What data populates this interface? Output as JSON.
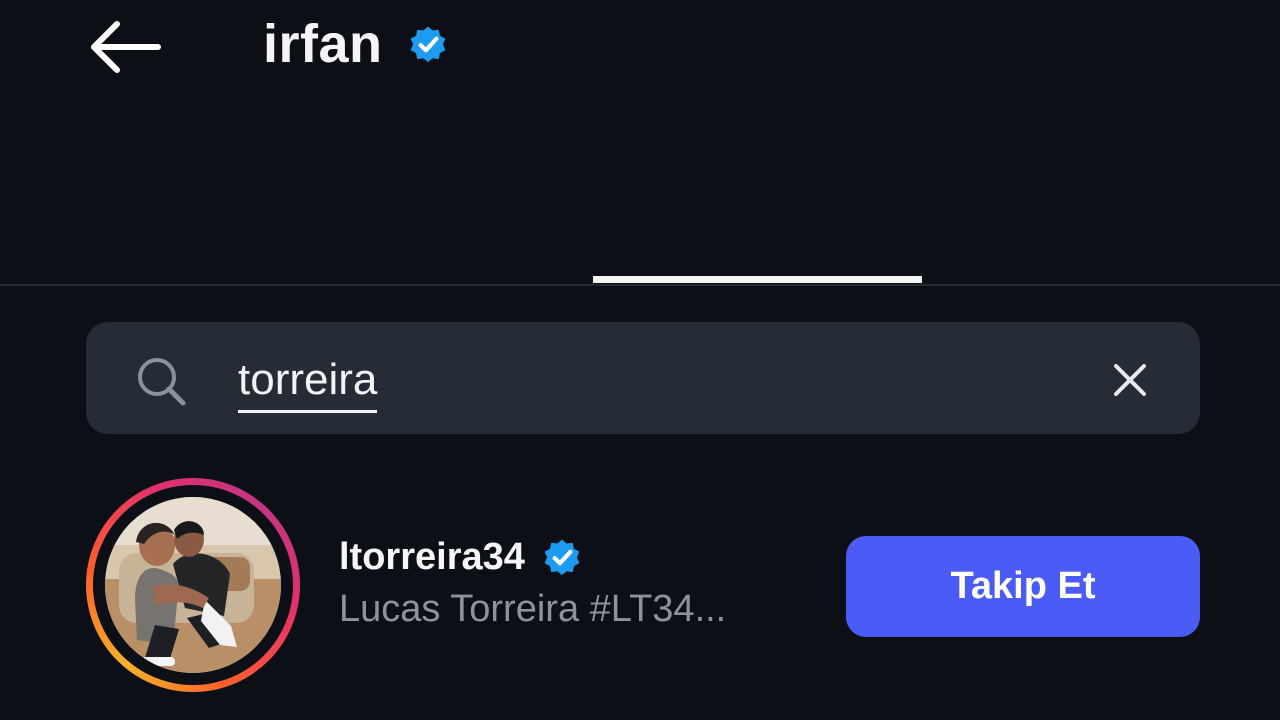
{
  "header": {
    "title": "irfan",
    "back_icon": "arrow-left-icon",
    "verified_icon": "verified-badge-icon"
  },
  "search": {
    "value": "torreira",
    "search_icon": "search-icon",
    "clear_icon": "close-icon"
  },
  "results": [
    {
      "username": "ltorreira34",
      "full_name": "Lucas Torreira #LT34...",
      "verified": true,
      "follow_label": "Takip Et",
      "avatar_icon": "profile-photo",
      "story_ring": true
    }
  ],
  "colors": {
    "background": "#0c0f15",
    "search_field": "#262c36",
    "verified_blue": "#1d9bf0",
    "follow_button": "#4b5cf6",
    "secondary_text": "#8d939d"
  }
}
